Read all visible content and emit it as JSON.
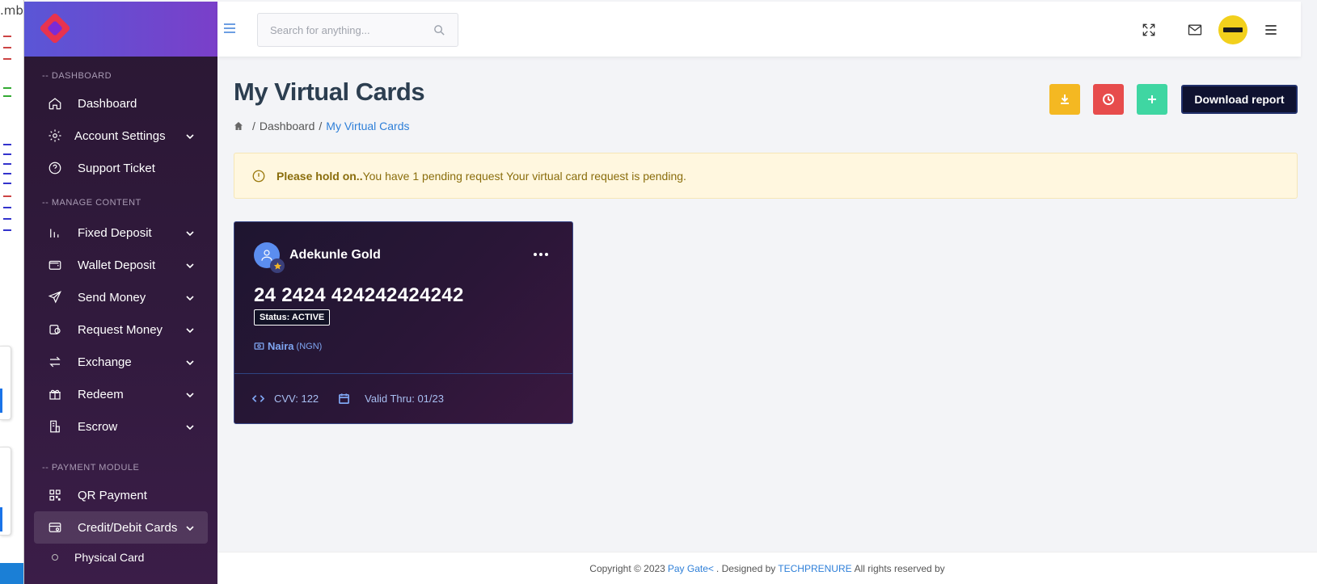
{
  "left_window": {
    "fragment_text": ".mb"
  },
  "sidebar": {
    "sections": [
      {
        "title": "-- DASHBOARD"
      },
      {
        "title": "-- MANAGE CONTENT"
      },
      {
        "title": "-- PAYMENT MODULE"
      }
    ],
    "items": [
      {
        "label": "Dashboard",
        "icon": "home-icon",
        "has_children": false
      },
      {
        "label": "Account Settings",
        "icon": "gear-icon",
        "has_children": true
      },
      {
        "label": "Support Ticket",
        "icon": "help-circle-icon",
        "has_children": false
      },
      {
        "label": "Fixed Deposit",
        "icon": "bar-chart-icon",
        "has_children": true
      },
      {
        "label": "Wallet Deposit",
        "icon": "wallet-icon",
        "has_children": true
      },
      {
        "label": "Send Money",
        "icon": "send-icon",
        "has_children": true
      },
      {
        "label": "Request Money",
        "icon": "request-money-icon",
        "has_children": true
      },
      {
        "label": "Exchange",
        "icon": "exchange-icon",
        "has_children": true
      },
      {
        "label": "Redeem",
        "icon": "gift-icon",
        "has_children": true
      },
      {
        "label": "Escrow",
        "icon": "escrow-icon",
        "has_children": true
      },
      {
        "label": "QR Payment",
        "icon": "qr-code-icon",
        "has_children": false
      },
      {
        "label": "Credit/Debit Cards",
        "icon": "credit-card-icon",
        "has_children": true,
        "active": true
      }
    ],
    "sub_items": [
      {
        "label": "Physical Card"
      }
    ]
  },
  "topbar": {
    "search_placeholder": "Search for anything...",
    "icons": [
      "menu-icon",
      "search-icon",
      "fullscreen-icon",
      "mail-icon",
      "avatar",
      "hamburger-icon"
    ],
    "avatar_color": "#f2d01c"
  },
  "page": {
    "title": "My Virtual Cards",
    "breadcrumb": {
      "separator": "/",
      "parent": "Dashboard",
      "current": "My Virtual Cards"
    },
    "actions": [
      {
        "name": "download-button",
        "icon": "download-icon",
        "color": "#f4b822"
      },
      {
        "name": "history-button",
        "icon": "clock-icon",
        "color": "#e74c4c"
      },
      {
        "name": "add-button",
        "icon": "plus-icon",
        "color": "#3fd6a2"
      }
    ],
    "download_report_label": "Download report"
  },
  "alert": {
    "bold": "Please hold on..",
    "message": "You have 1 pending request Your virtual card request is pending."
  },
  "card": {
    "holder": "Adekunle Gold",
    "number": "24 2424 424242424242",
    "status": "Status: ACTIVE",
    "currency_name": "Naira",
    "currency_code": "(NGN)",
    "cvv": "CVV: 122",
    "valid_thru": "Valid Thru: 01/23"
  },
  "footer": {
    "prefix": "Copyright © 2023",
    "brand": "Pay Gate<",
    "middle": ". Designed by",
    "designer": "TECHPRENURE",
    "suffix": "All rights reserved by"
  },
  "colors": {
    "accent": "#2e7fd8",
    "sidebar_top": "#5a56d6",
    "sidebar_bg": "#2a1733",
    "alert_bg": "#fff7df"
  }
}
